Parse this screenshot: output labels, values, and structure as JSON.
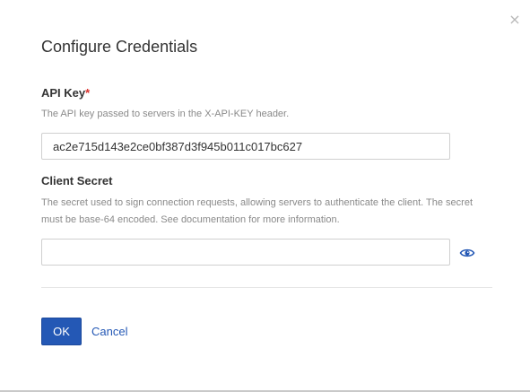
{
  "dialog": {
    "title": "Configure Credentials",
    "close_glyph": "×"
  },
  "api_key": {
    "label": "API Key",
    "required_mark": "*",
    "help": "The API key passed to servers in the X-API-KEY header.",
    "value": "ac2e715d143e2ce0bf387d3f945b011c017bc627"
  },
  "client_secret": {
    "label": "Client Secret",
    "help": "The secret used to sign connection requests, allowing servers to authenticate the client. The secret must be base-64 encoded. See documentation for more information.",
    "value": "",
    "toggle_icon": "eye-icon"
  },
  "actions": {
    "ok_label": "OK",
    "cancel_label": "Cancel"
  },
  "colors": {
    "primary": "#2458b5",
    "required": "#d9302c",
    "help_text": "#8a8a8a"
  }
}
